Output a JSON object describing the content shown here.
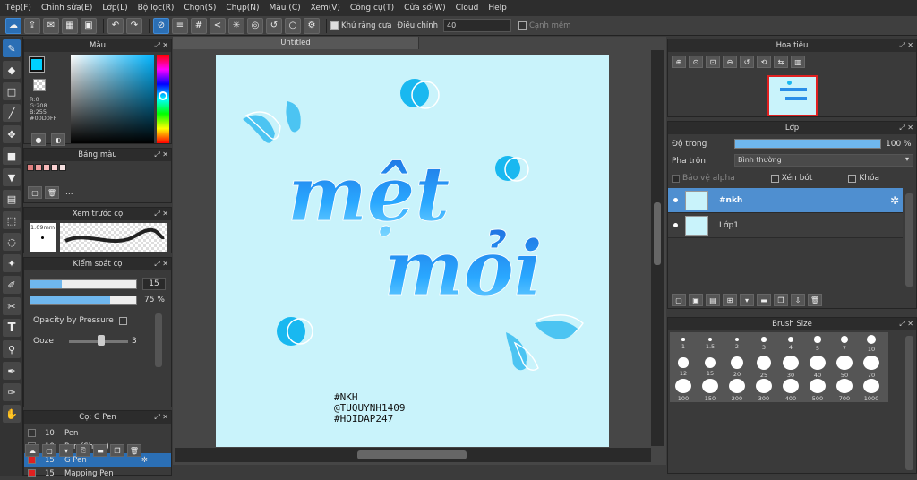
{
  "menu": [
    "Tệp(F)",
    "Chỉnh sửa(E)",
    "Lớp(L)",
    "Bộ lọc(R)",
    "Chọn(S)",
    "Chụp(N)",
    "Màu (C)",
    "Xem(V)",
    "Công cụ(T)",
    "Cửa sổ(W)",
    "Cloud",
    "Help"
  ],
  "toolbar": {
    "antialias_label": "Khử răng cưa",
    "adjust_label": "Điều chỉnh",
    "adjust_value": "40",
    "smooth_label": "Cạnh mềm"
  },
  "color_panel": {
    "title": "Màu",
    "r": "R:0",
    "g": "G:208",
    "b": "B:255",
    "hex": "#00D0FF",
    "fg_color": "#00D0FF"
  },
  "palette_panel": {
    "title": "Bảng màu",
    "swatches": [
      "#e08080",
      "#f0a0a0",
      "#f7b9b9",
      "#fbd2d2",
      "#f5e0e0"
    ],
    "more": "..."
  },
  "brush_preview": {
    "title": "Xem trước cọ",
    "size": "1.09mm"
  },
  "brush_control": {
    "title": "Kiểm soát cọ",
    "size_value": "15",
    "size_fraction": 0.3,
    "opacity_value": "75 %",
    "opacity_fraction": 0.75,
    "pressure_label": "Opacity by Pressure",
    "ooze_label": "Ooze",
    "ooze_value": "3"
  },
  "brush_list": {
    "title": "Cọ: G Pen",
    "items": [
      {
        "size": "10",
        "name": "Pen",
        "color": "#333333",
        "selected": false
      },
      {
        "size": "10",
        "name": "Pen (Sharp)",
        "color": "#333333",
        "selected": false
      },
      {
        "size": "15",
        "name": "G Pen",
        "color": "#e02020",
        "selected": true
      },
      {
        "size": "15",
        "name": "Mapping Pen",
        "color": "#e02020",
        "selected": false
      }
    ]
  },
  "document": {
    "tab_title": "Untitled",
    "line1": "mệt",
    "line2": "mỏi",
    "credit1": "#NKH",
    "credit2": "@TUQUYNH1409",
    "credit3": "#HOIDAP247"
  },
  "navigator": {
    "title": "Hoa tiêu"
  },
  "layer_panel": {
    "title": "Lớp",
    "opacity_label": "Độ trong",
    "opacity_value": "100 %",
    "opacity_fraction": 1.0,
    "blend_label": "Pha trộn",
    "blend_value": "Bình thường",
    "protect_alpha": "Bảo vệ alpha",
    "clip": "Xén bớt",
    "lock": "Khóa",
    "layers": [
      {
        "name": "#nkh",
        "selected": true
      },
      {
        "name": "Lớp1",
        "selected": false
      }
    ]
  },
  "brush_size_panel": {
    "title": "Brush Size",
    "sizes": [
      "1",
      "1.5",
      "2",
      "3",
      "4",
      "5",
      "7",
      "10",
      "12",
      "15",
      "20",
      "25",
      "30",
      "40",
      "50",
      "70",
      "100",
      "150",
      "200",
      "300",
      "400",
      "500",
      "700",
      "1000"
    ]
  }
}
